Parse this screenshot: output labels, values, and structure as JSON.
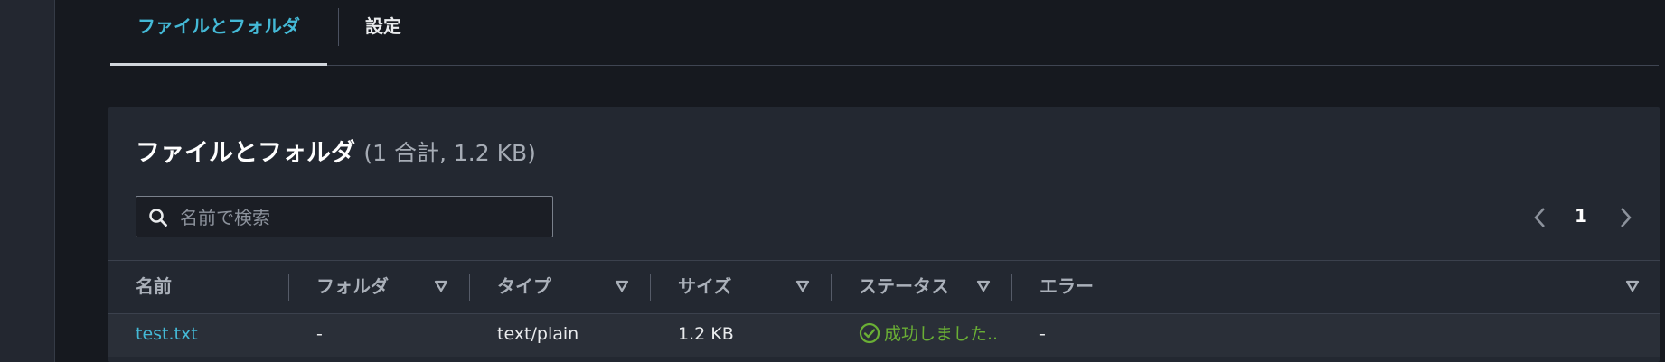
{
  "tabs": [
    {
      "label": "ファイルとフォルダ",
      "active": true
    },
    {
      "label": "設定",
      "active": false
    }
  ],
  "panel": {
    "title": "ファイルとフォルダ",
    "count": "(1 合計, 1.2 KB)"
  },
  "search": {
    "placeholder": "名前で検索",
    "value": ""
  },
  "pagination": {
    "current_page": "1"
  },
  "table": {
    "columns": [
      "名前",
      "フォルダ",
      "タイプ",
      "サイズ",
      "ステータス",
      "エラー"
    ],
    "rows": [
      {
        "name": "test.txt",
        "folder": "-",
        "type": "text/plain",
        "size": "1.2 KB",
        "status": "成功しました..",
        "error": "-"
      }
    ]
  },
  "colors": {
    "accent": "#44b9d6",
    "success": "#6aaf35",
    "background": "#16191f",
    "panel": "#232831"
  },
  "icons": {
    "search": "search-icon",
    "prev": "chevron-left-icon",
    "next": "chevron-right-icon",
    "sort": "caret-down-icon",
    "status": "check-circle-icon"
  }
}
